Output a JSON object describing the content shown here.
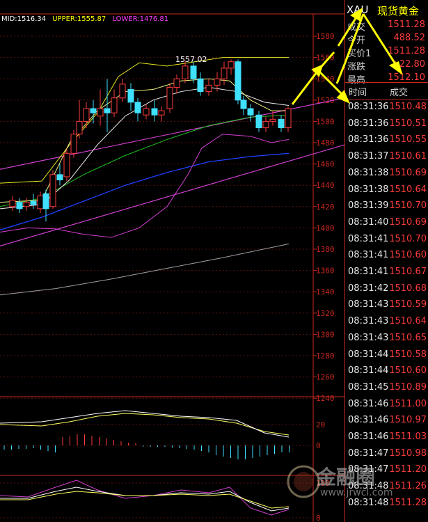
{
  "indicator": {
    "mid": "MID:1516.34",
    "upper": "UPPER:1555.87",
    "lower": "LOWER:1476.81",
    "colors": {
      "mid": "#ffffff",
      "upper": "#ffff00",
      "lower": "#ff40ff"
    }
  },
  "main_chart": {
    "y_ticks": [
      "1580",
      "1560",
      "1540",
      "1520",
      "1500",
      "1480",
      "1460",
      "1440",
      "1420",
      "1400",
      "1380",
      "1360",
      "1340",
      "1320",
      "1300",
      "1280",
      "1260",
      "1240"
    ],
    "high_label": "1557.02"
  },
  "sub_chart1": {
    "y_ticks": [
      "20",
      "0"
    ]
  },
  "sub_chart2": {
    "y_ticks": [
      "100",
      "0"
    ]
  },
  "quote": {
    "symbol": "XAU",
    "name": "现货黄金",
    "rows": [
      {
        "label": "成交",
        "value": "1511.28"
      },
      {
        "label": "今开",
        "value": "488.52"
      },
      {
        "label": "买价1",
        "value": "1511.28"
      },
      {
        "label": "涨跌",
        "value": "+22.80"
      },
      {
        "label": "最高",
        "value": "1512.10"
      }
    ]
  },
  "ticks_header": {
    "time": "时间",
    "price": "成交"
  },
  "ticks": [
    {
      "time": "08:31:36",
      "price": "1510.48"
    },
    {
      "time": "08:31:36",
      "price": "1510.51"
    },
    {
      "time": "08:31:36",
      "price": "1510.55"
    },
    {
      "time": "08:31:37",
      "price": "1510.61"
    },
    {
      "time": "08:31:38",
      "price": "1510.69"
    },
    {
      "time": "08:31:38",
      "price": "1510.64"
    },
    {
      "time": "08:31:39",
      "price": "1510.70"
    },
    {
      "time": "08:31:40",
      "price": "1510.69"
    },
    {
      "time": "08:31:41",
      "price": "1510.70"
    },
    {
      "time": "08:31:41",
      "price": "1510.60"
    },
    {
      "time": "08:31:41",
      "price": "1510.67"
    },
    {
      "time": "08:31:42",
      "price": "1510.68"
    },
    {
      "time": "08:31:43",
      "price": "1510.59"
    },
    {
      "time": "08:31:43",
      "price": "1510.64"
    },
    {
      "time": "08:31:43",
      "price": "1510.65"
    },
    {
      "time": "08:31:44",
      "price": "1510.58"
    },
    {
      "time": "08:31:44",
      "price": "1510.60"
    },
    {
      "time": "08:31:45",
      "price": "1510.89"
    },
    {
      "time": "08:31:46",
      "price": "1511.00"
    },
    {
      "time": "08:31:46",
      "price": "1510.97"
    },
    {
      "time": "08:31:46",
      "price": "1511.03"
    },
    {
      "time": "08:31:47",
      "price": "1510.98"
    },
    {
      "time": "08:31:47",
      "price": "1511.20"
    },
    {
      "time": "08:31:48",
      "price": "1511.26"
    },
    {
      "time": "08:31:48",
      "price": "1511.28"
    }
  ],
  "watermark": {
    "text": "金融圈",
    "url": "www.jrwcl.com"
  }
}
